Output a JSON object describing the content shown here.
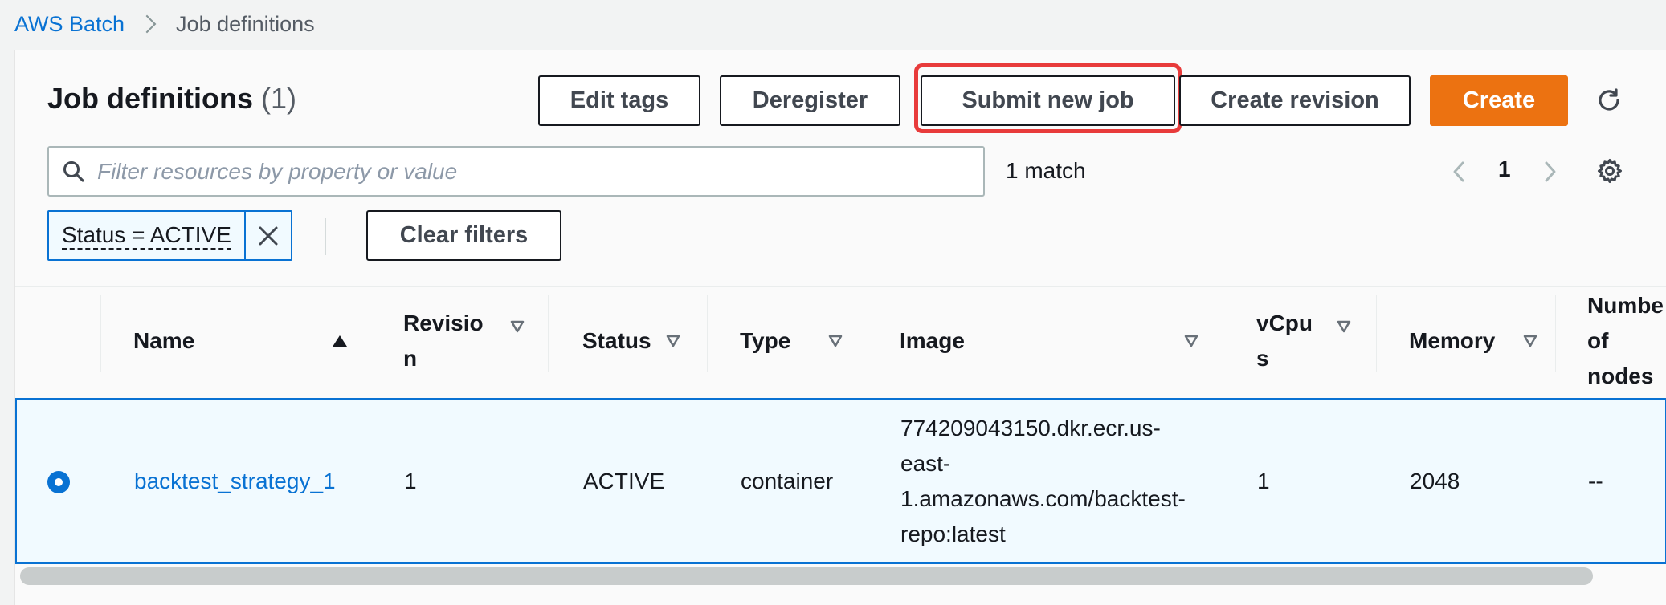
{
  "breadcrumb": {
    "root": "AWS Batch",
    "current": "Job definitions"
  },
  "header": {
    "title": "Job definitions",
    "count": "(1)"
  },
  "toolbar": {
    "edit_tags": "Edit tags",
    "deregister": "Deregister",
    "submit_new_job": "Submit new job",
    "create_revision": "Create revision",
    "create": "Create"
  },
  "search": {
    "placeholder": "Filter resources by property or value",
    "value": ""
  },
  "match_text": "1 match",
  "pagination": {
    "current": "1"
  },
  "filter_token": {
    "label": "Status = ACTIVE"
  },
  "clear_filters": "Clear filters",
  "table": {
    "columns": [
      {
        "label": "Name"
      },
      {
        "label": "Revisio\nn"
      },
      {
        "label": "Status"
      },
      {
        "label": "Type"
      },
      {
        "label": "Image"
      },
      {
        "label": "vCpu\ns"
      },
      {
        "label": "Memory"
      },
      {
        "label": "Numbe\nof\nnodes"
      }
    ],
    "rows": [
      {
        "name": "backtest_strategy_1",
        "revision": "1",
        "status": "ACTIVE",
        "type": "container",
        "image": "774209043150.dkr.ecr.us-\neast-\n1.amazonaws.com/backtest-\nrepo:latest",
        "vcpus": "1",
        "memory": "2048",
        "nodes": "--"
      }
    ]
  },
  "colors": {
    "link": "#0972d3",
    "primary": "#ec7211",
    "highlight": "#e83b3b",
    "selected_row_bg": "#f1faff"
  },
  "icons": [
    "chevron-right-icon",
    "refresh-icon",
    "search-icon",
    "chevron-left-icon",
    "chevron-right-icon",
    "gear-icon",
    "close-icon",
    "sort-ascending-icon",
    "sort-descending-icon"
  ]
}
